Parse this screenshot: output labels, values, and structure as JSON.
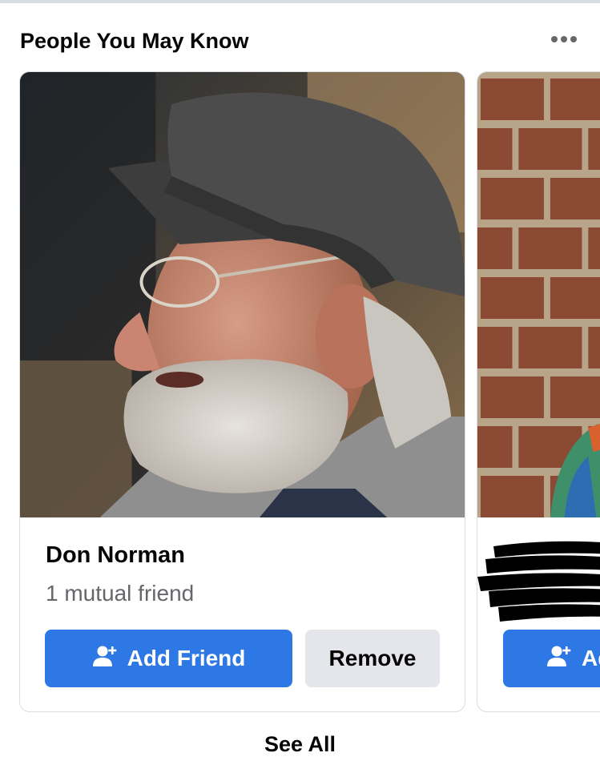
{
  "section": {
    "title": "People You May Know",
    "more_icon": "more-horizontal-icon"
  },
  "cards": [
    {
      "name": "Don Norman",
      "mutual_friends": "1 mutual friend",
      "add_label": "Add Friend",
      "remove_label": "Remove",
      "add_icon": "add-friend-icon"
    },
    {
      "name_redacted": true,
      "add_label": "Ad",
      "add_icon": "add-friend-icon"
    }
  ],
  "footer": {
    "see_all_label": "See All"
  },
  "colors": {
    "primary": "#2d78e4",
    "secondary_button": "#e4e6eb",
    "text": "#050505",
    "muted_text": "#65676b",
    "border": "#dadde1"
  }
}
